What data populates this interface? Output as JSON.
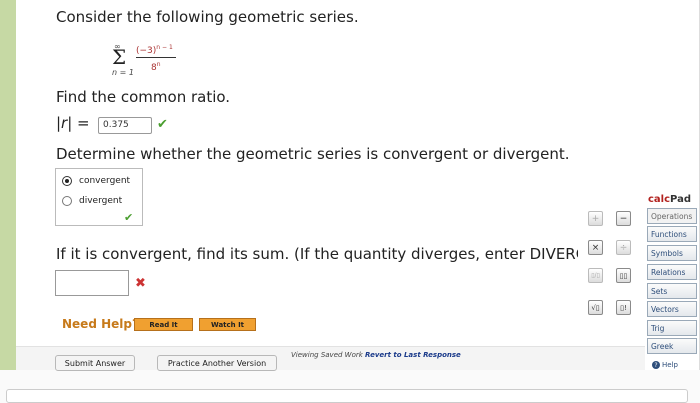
{
  "question": {
    "prompt": "Consider the following geometric series.",
    "series": {
      "upper": "∞",
      "symbol": "Σ",
      "lower": "n = 1",
      "numerator": "(−3)n − 1",
      "denominator": "8n"
    },
    "ratio_prompt": "Find the common ratio.",
    "ratio_label": "|r|  =",
    "ratio_value": "0.375",
    "convergence_prompt": "Determine whether the geometric series is convergent or divergent.",
    "options": [
      {
        "label": "convergent",
        "selected": true
      },
      {
        "label": "divergent",
        "selected": false
      }
    ],
    "sum_prompt": "If it is convergent, find its sum. (If the quantity diverges, enter DIVERGE",
    "sum_value": ""
  },
  "help": {
    "label": "Need Help?",
    "read_it": "Read It",
    "watch_it": "Watch It"
  },
  "actions": {
    "submit": "Submit Answer",
    "practice": "Practice Another Version"
  },
  "saved": {
    "text": "Viewing Saved Work",
    "link": "Revert to Last Response"
  },
  "status_icons": {
    "correct": "✔",
    "incorrect": "✖"
  },
  "calcpad": {
    "title_calc": "calc",
    "title_pad": "Pad",
    "tabs": [
      "Operations",
      "Functions",
      "Symbols",
      "Relations",
      "Sets",
      "Vectors",
      "Trig",
      "Greek"
    ],
    "help": "Help",
    "buttons": [
      "+",
      "−",
      "×",
      "÷",
      "▯/▯",
      "▯▯",
      "√▯",
      "▯!"
    ]
  },
  "colors": {
    "accent": "#c6d9a4",
    "correct": "#4a9e2f",
    "incorrect": "#cc3333",
    "help": "#f0a030",
    "brand": "#b2211e"
  }
}
